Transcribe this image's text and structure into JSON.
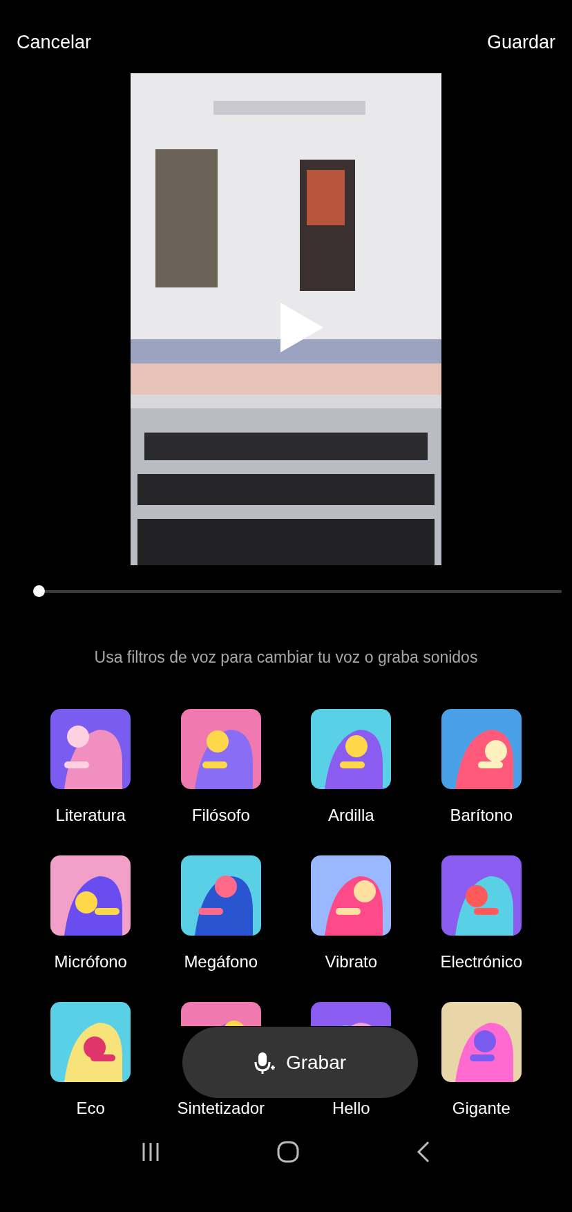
{
  "header": {
    "cancel": "Cancelar",
    "save": "Guardar"
  },
  "scrubber": {
    "level": 0
  },
  "hint": "Usa filtros de voz para cambiar tu voz o graba sonidos",
  "effects": [
    {
      "label": "Literatura"
    },
    {
      "label": "Filósofo"
    },
    {
      "label": "Ardilla"
    },
    {
      "label": "Barítono"
    },
    {
      "label": "Micrófono"
    },
    {
      "label": "Megáfono"
    },
    {
      "label": "Vibrato"
    },
    {
      "label": "Electrónico"
    },
    {
      "label": "Eco"
    },
    {
      "label": "Sintetizador"
    },
    {
      "label": "Hello"
    },
    {
      "label": "Gigante"
    }
  ],
  "record_button": {
    "label": "Grabar"
  }
}
